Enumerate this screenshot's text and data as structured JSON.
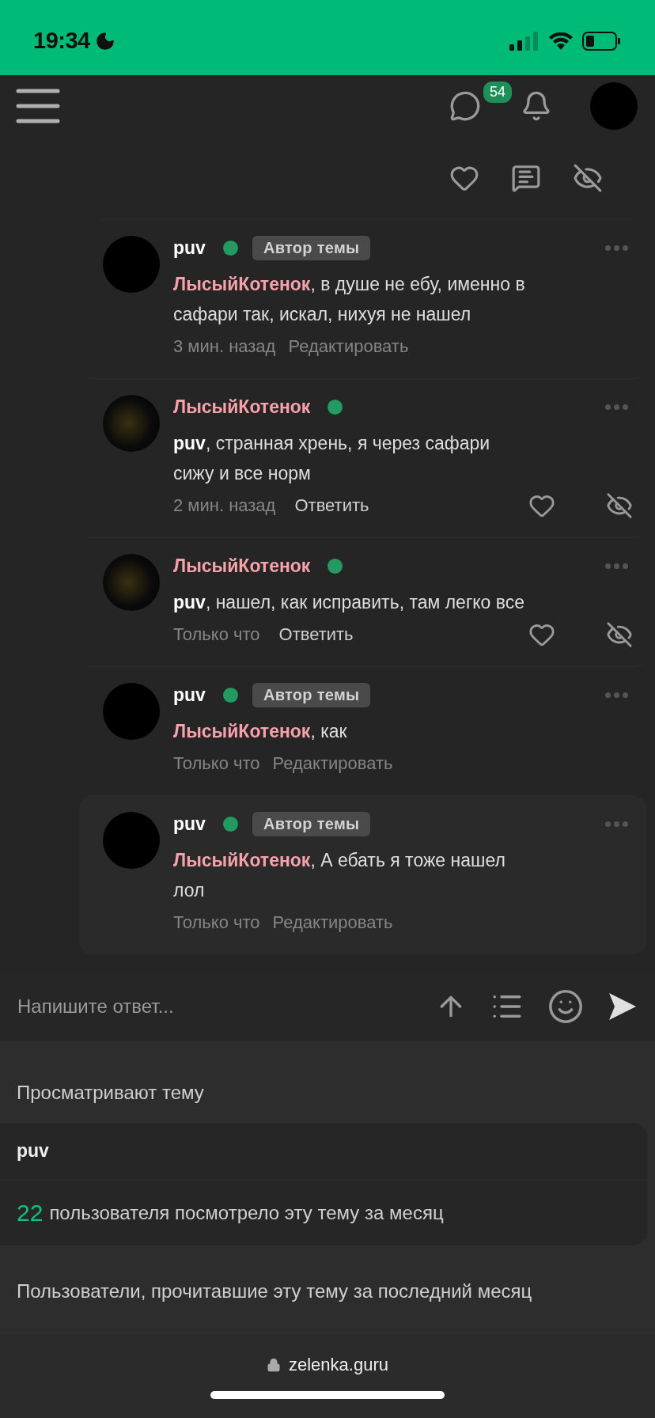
{
  "status_bar": {
    "time": "19:34"
  },
  "header": {
    "messages_badge": "54"
  },
  "comments": [
    {
      "author": "puv",
      "kind": "own",
      "online": true,
      "badge": "Автор темы",
      "mention": "ЛысыйКотенок",
      "text": ", в душе не ебу, именно в сафари так, искал, нихуя не нашел",
      "time": "3 мин. назад",
      "action": {
        "label": "Редактировать",
        "kind": "edit"
      },
      "highlighted": false
    },
    {
      "author": "ЛысыйКотенок",
      "kind": "other",
      "online": true,
      "mention": "puv",
      "text": ", странная хрень, я через сафари сижу и все норм",
      "time": "2 мин. назад",
      "action": {
        "label": "Ответить",
        "kind": "reply"
      },
      "highlighted": false
    },
    {
      "author": "ЛысыйКотенок",
      "kind": "other",
      "online": true,
      "mention": "puv",
      "text": ", нашел, как исправить, там легко все",
      "time": "Только что",
      "action": {
        "label": "Ответить",
        "kind": "reply"
      },
      "highlighted": false
    },
    {
      "author": "puv",
      "kind": "own",
      "online": true,
      "badge": "Автор темы",
      "mention": "ЛысыйКотенок",
      "text": ", как",
      "time": "Только что",
      "action": {
        "label": "Редактировать",
        "kind": "edit"
      },
      "highlighted": false
    },
    {
      "author": "puv",
      "kind": "own",
      "online": true,
      "badge": "Автор темы",
      "mention": "ЛысыйКотенок",
      "text": ", А ебать я тоже нашел лол",
      "time": "Только что",
      "action": {
        "label": "Редактировать",
        "kind": "edit"
      },
      "highlighted": true
    }
  ],
  "reply_box": {
    "placeholder": "Напишите ответ..."
  },
  "viewers": {
    "title": "Просматривают тему",
    "users": [
      "puv"
    ],
    "count": "22",
    "count_text": "пользователя посмотрело эту тему за месяц"
  },
  "readers": {
    "title": "Пользователи, прочитавшие эту тему за последний месяц"
  },
  "browser_bar": {
    "url": "zelenka.guru"
  }
}
